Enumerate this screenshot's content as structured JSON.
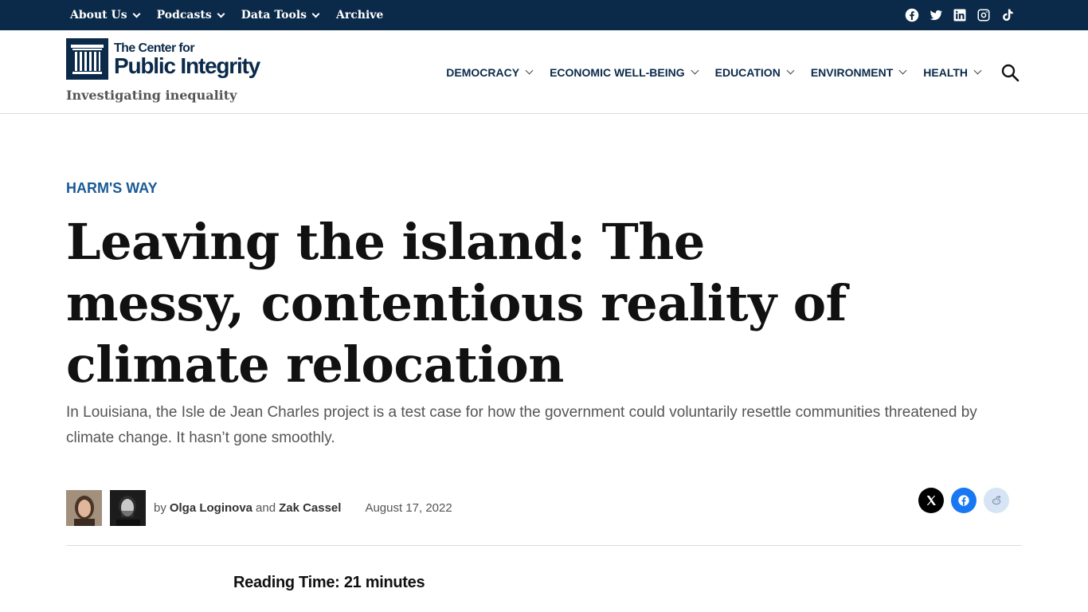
{
  "topbar": {
    "nav": [
      {
        "label": "About Us",
        "has_dropdown": true
      },
      {
        "label": "Podcasts",
        "has_dropdown": true
      },
      {
        "label": "Data Tools",
        "has_dropdown": true
      },
      {
        "label": "Archive",
        "has_dropdown": false
      }
    ],
    "social_icons": [
      "facebook-icon",
      "twitter-icon",
      "linkedin-icon",
      "instagram-icon",
      "tiktok-icon"
    ],
    "background_color": "#0b2a4a"
  },
  "header": {
    "logo_line1": "The Center for",
    "logo_line2": "Public Integrity",
    "tagline": "Investigating inequality",
    "nav": [
      {
        "label": "DEMOCRACY"
      },
      {
        "label": "ECONOMIC WELL-BEING"
      },
      {
        "label": "EDUCATION"
      },
      {
        "label": "ENVIRONMENT"
      },
      {
        "label": "HEALTH"
      }
    ],
    "search_icon": "search-icon"
  },
  "article": {
    "kicker": "HARM'S WAY",
    "headline": "Leaving the island: The messy, contentious reality of climate relocation",
    "dek": "In Louisiana, the Isle de Jean Charles project is a test case for how the government could voluntarily resettle communities threatened by climate change. It hasn’t gone smoothly.",
    "byline_prefix": "by",
    "author1": "Olga Loginova",
    "conjunction": "and",
    "author2": "Zak Cassel",
    "date": "August 17, 2022",
    "reading_time_label": "Reading Time:",
    "reading_time_value": "21 minutes"
  },
  "share": {
    "buttons": [
      "x-share",
      "facebook-share",
      "reddit-share"
    ],
    "colors": {
      "x": "#000000",
      "facebook": "#1877f2",
      "reddit": "#d6e4f5"
    }
  },
  "colors": {
    "accent": "#1a5a96",
    "navy": "#0b2a4a"
  }
}
